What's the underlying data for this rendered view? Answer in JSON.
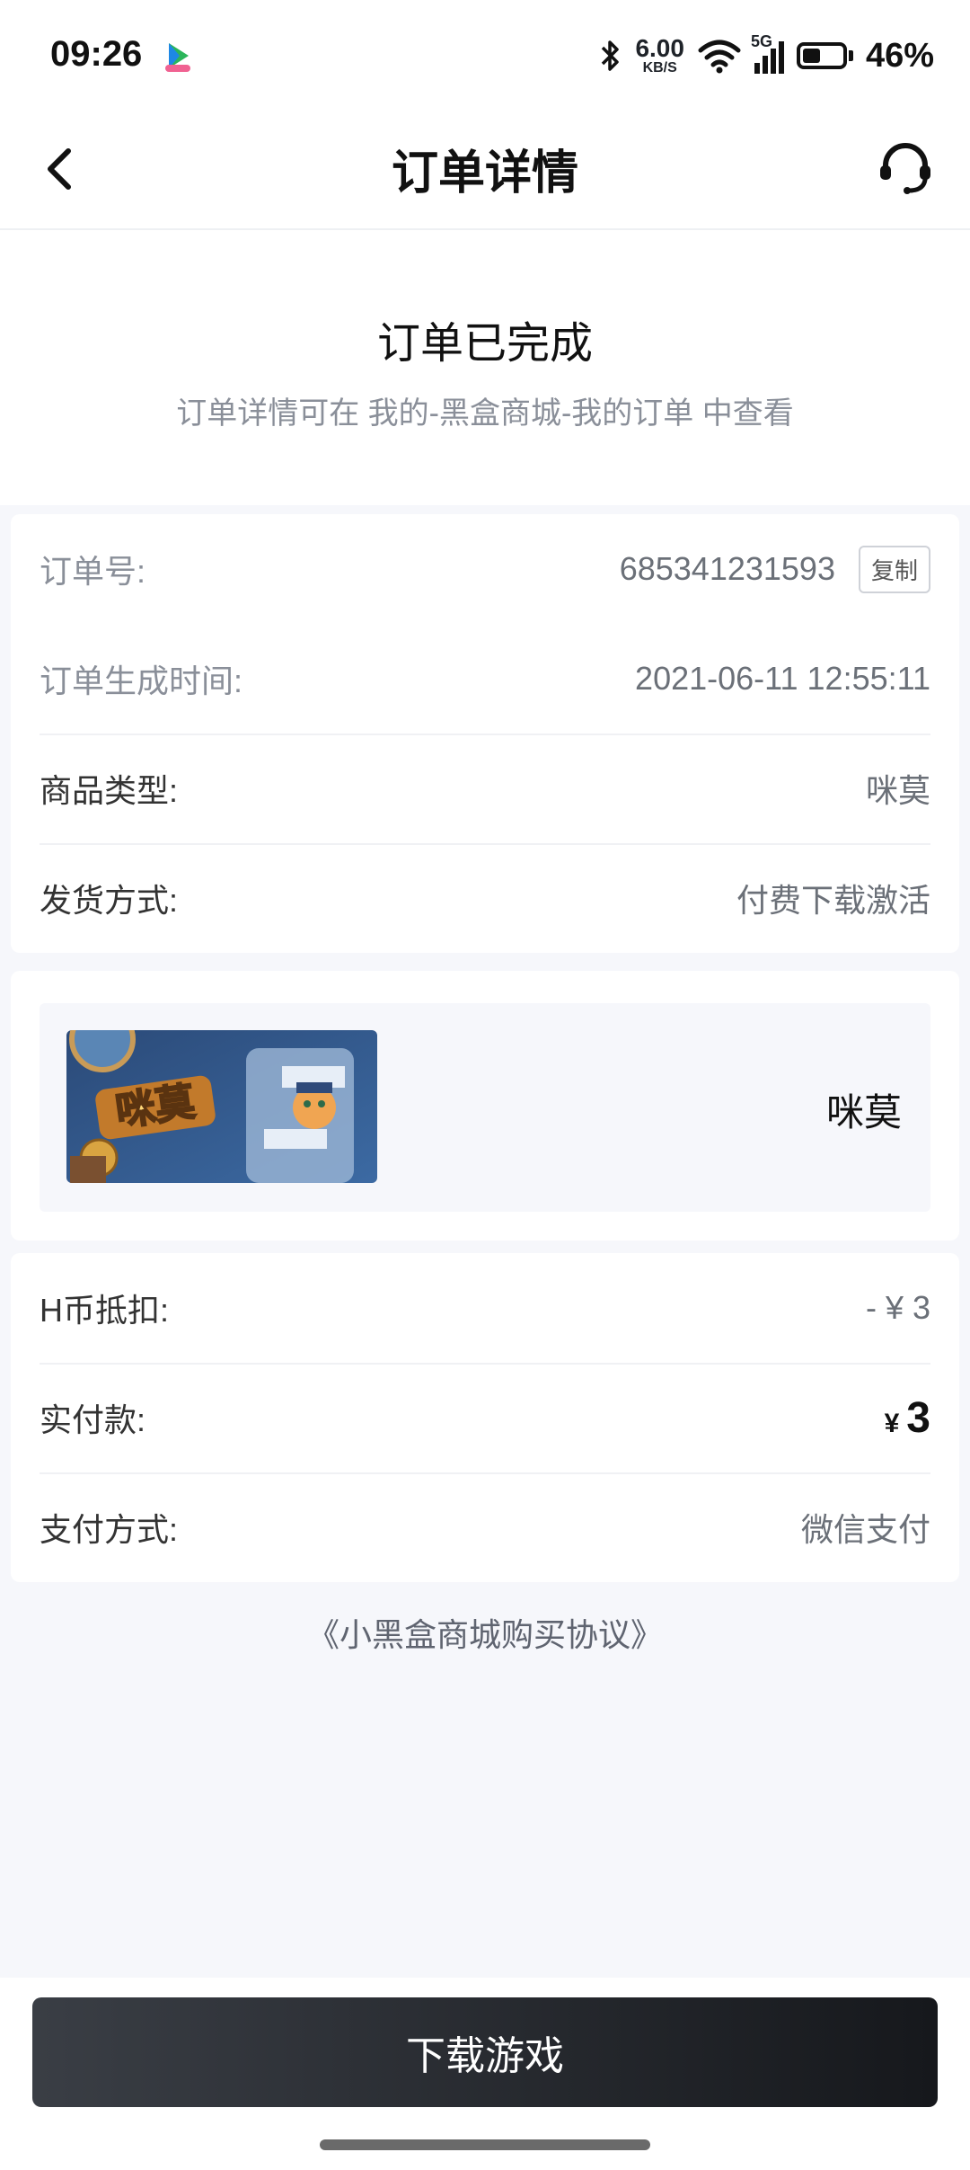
{
  "status_bar": {
    "time": "09:26",
    "speed_value": "6.00",
    "speed_unit": "KB/S",
    "network": "5G",
    "battery_percent": "46%",
    "battery_level": 0.46
  },
  "nav": {
    "title": "订单详情",
    "back_icon": "chevron-left-icon",
    "service_icon": "headset-icon"
  },
  "order_status": {
    "title": "订单已完成",
    "subtitle": "订单详情可在 我的-黑盒商城-我的订单 中查看"
  },
  "order_info": {
    "order_no_label": "订单号:",
    "order_no": "685341231593",
    "copy_label": "复制",
    "created_label": "订单生成时间:",
    "created_time": "2021-06-11 12:55:11",
    "type_label": "商品类型:",
    "type_value": "咪莫",
    "delivery_label": "发货方式:",
    "delivery_value": "付费下载激活"
  },
  "product": {
    "thumbnail_text": "咪莫",
    "name": "咪莫"
  },
  "payment": {
    "coin_label": "H币抵扣:",
    "coin_value": "- ¥ 3",
    "paid_label": "实付款:",
    "paid_currency": "¥",
    "paid_amount": "3",
    "method_label": "支付方式:",
    "method_value": "微信支付"
  },
  "agreement": "《小黑盒商城购买协议》",
  "download_button": "下载游戏",
  "colors": {
    "background": "#f6f7fb",
    "button_start": "#3a3e45",
    "button_end": "#16181c"
  }
}
